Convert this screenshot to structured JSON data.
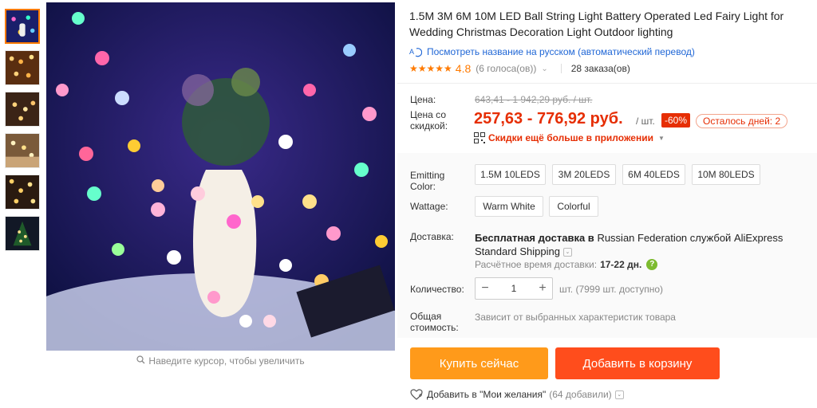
{
  "gallery": {
    "thumbnails": [
      "thumb-1",
      "thumb-2",
      "thumb-3",
      "thumb-4",
      "thumb-5",
      "thumb-6"
    ],
    "active_index": 0,
    "zoom_hint": "Наведите курсор, чтобы увеличить",
    "zoom_icon": "magnifier-icon"
  },
  "product": {
    "title": "1.5M 3M 6M 10M LED Ball String Light Battery Operated Led Fairy Light for Wedding Christmas Decoration Light Outdoor lighting",
    "translate_link": "Посмотреть название на русском (автоматический перевод)",
    "rating": {
      "stars": "★★★★★",
      "value": "4.8",
      "votes": "(6 голоса(ов))",
      "orders": "28 заказа(ов)"
    }
  },
  "price": {
    "price_label": "Цена:",
    "original": "643,41 - 1 942,29 руб. / шт.",
    "discount_label_line1": "Цена со",
    "discount_label_line2": "скидкой:",
    "discounted": "257,63 - 776,92 руб.",
    "per_unit": "/ шт.",
    "discount_badge": "-60%",
    "days_left": "Осталось дней: 2",
    "app_discount": "Скидки ещё больше в приложении"
  },
  "options": {
    "emitting_label_line1": "Emitting",
    "emitting_label_line2": "Color:",
    "emitting": [
      "1.5M 10LEDS",
      "3M 20LEDS",
      "6M 40LEDS",
      "10M 80LEDS"
    ],
    "wattage_label": "Wattage:",
    "wattage": [
      "Warm White",
      "Colorful"
    ]
  },
  "shipping": {
    "label": "Доставка:",
    "free_prefix": "Бесплатная доставка в",
    "country": "Russian Federation",
    "via": "службой",
    "service_line1": "AliExpress",
    "service_line2": "Standard Shipping",
    "eta_label": "Расчётное время доставки:",
    "eta_value": "17-22 дн."
  },
  "quantity": {
    "label": "Количество:",
    "minus": "−",
    "value": "1",
    "plus": "+",
    "note": "шт. (7999 шт. доступно)"
  },
  "total": {
    "label_line1": "Общая",
    "label_line2": "стоимость:",
    "note": "Зависит от выбранных характеристик товара"
  },
  "actions": {
    "buy_now": "Купить сейчас",
    "add_to_cart": "Добавить в корзину",
    "wishlist": "Добавить в \"Мои желания\"",
    "wishlist_count": "(64 добавили)"
  },
  "colors": {
    "accent_orange": "#ff9a1a",
    "cart_red": "#ff4d1c",
    "price_red": "#e62e04",
    "link_blue": "#2067d6",
    "star_orange": "#ff7a00"
  }
}
